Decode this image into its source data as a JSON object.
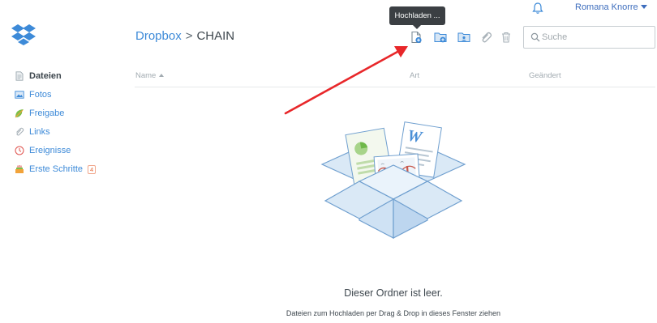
{
  "header": {
    "user_name": "Romana Knorre",
    "tooltip": "Hochladen ..."
  },
  "breadcrumb": {
    "root": "Dropbox",
    "separator": ">",
    "current": "CHAIN"
  },
  "toolbar": {
    "icons": [
      "upload-file-icon",
      "new-folder-icon",
      "shared-folder-icon",
      "link-icon",
      "trash-icon"
    ],
    "search_placeholder": "Suche"
  },
  "sidebar": {
    "items": [
      {
        "label": "Dateien",
        "icon": "files-icon",
        "active": true
      },
      {
        "label": "Fotos",
        "icon": "photos-icon"
      },
      {
        "label": "Freigabe",
        "icon": "sharing-icon"
      },
      {
        "label": "Links",
        "icon": "links-icon"
      },
      {
        "label": "Ereignisse",
        "icon": "events-icon"
      },
      {
        "label": "Erste Schritte",
        "icon": "get-started-icon",
        "badge": "4"
      }
    ]
  },
  "columns": {
    "name": "Name",
    "kind": "Art",
    "modified": "Geändert"
  },
  "empty_state": {
    "title": "Dieser Ordner ist leer.",
    "subtitle": "Dateien zum Hochladen per Drag & Drop in dieses Fenster ziehen"
  },
  "colors": {
    "accent": "#3d8ad8",
    "tooltip_bg": "#3b3f43",
    "annotation": "#e8272a"
  }
}
